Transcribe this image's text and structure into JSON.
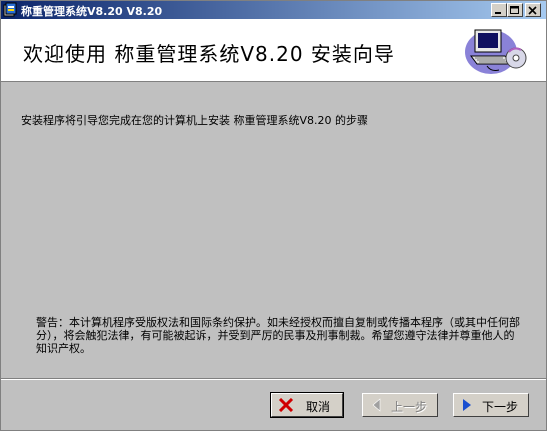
{
  "window": {
    "title": "称重管理系统V8.20 V8.20"
  },
  "header": {
    "title": "欢迎使用 称重管理系统V8.20 安装向导"
  },
  "content": {
    "intro": "安装程序将引导您完成在您的计算机上安装 称重管理系统V8.20 的步骤",
    "warning": "警告：本计算机程序受版权法和国际条约保护。如未经授权而擅自复制或传播本程序（或其中任何部分），将会触犯法律，有可能被起诉，并受到严厉的民事及刑事制裁。希望您遵守法律并尊重他人的知识产权。"
  },
  "buttons": {
    "cancel": "取消",
    "back": "上一步",
    "next": "下一步"
  },
  "colors": {
    "titlebar_start": "#0a246a",
    "titlebar_end": "#a6caf0",
    "content_bg": "#c0c0c0",
    "cancel_icon": "#d00000",
    "next_icon": "#1a4fd0"
  },
  "icons": {
    "app": "setup-icon",
    "minimize": "minimize-icon",
    "maximize": "maximize-icon",
    "close": "close-icon",
    "logo": "computer-cd-icon",
    "cancel": "red-x-icon",
    "back": "arrow-left-icon",
    "next": "arrow-right-icon"
  }
}
